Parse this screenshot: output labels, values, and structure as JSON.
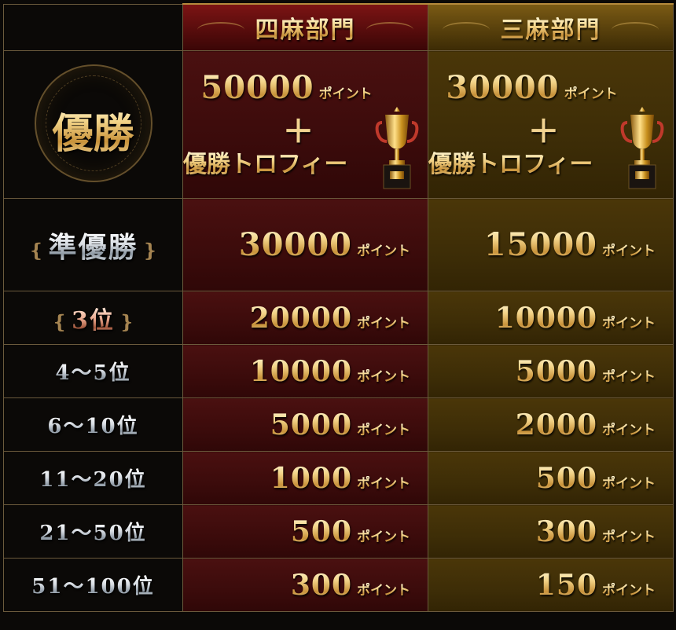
{
  "header": {
    "four_player": "四麻部門",
    "three_player": "三麻部門"
  },
  "unit_label": "ポイント",
  "plus_sign": "＋",
  "trophy_label": "優勝トロフィー",
  "rows": [
    {
      "rank": "優勝",
      "four": "50000",
      "three": "30000"
    },
    {
      "rank": "準優勝",
      "four": "30000",
      "three": "15000"
    },
    {
      "rank": "3位",
      "four": "20000",
      "three": "10000"
    },
    {
      "rank": "4～5位",
      "four": "10000",
      "three": "5000"
    },
    {
      "rank": "6～10位",
      "four": "5000",
      "three": "2000"
    },
    {
      "rank": "11～20位",
      "four": "1000",
      "three": "500"
    },
    {
      "rank": "21～50位",
      "four": "500",
      "three": "300"
    },
    {
      "rank": "51～100位",
      "four": "300",
      "three": "150"
    }
  ],
  "colors": {
    "four_bg": "#3b0b0b",
    "three_bg": "#3d2d07",
    "gold": "#f3d489",
    "border": "#6b5a3c"
  },
  "icons": [
    "trophy-icon"
  ]
}
